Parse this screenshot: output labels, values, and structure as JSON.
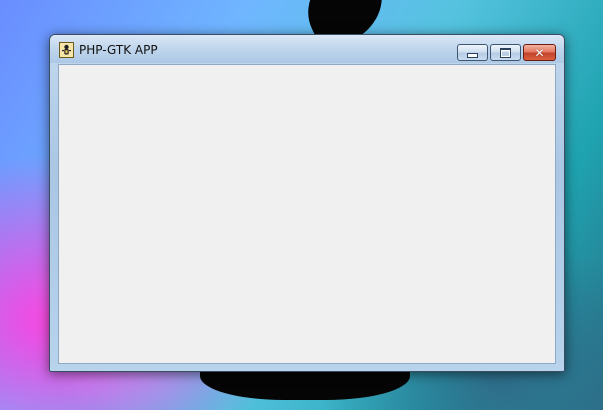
{
  "window": {
    "title": "PHP-GTK APP",
    "app_icon": "php-gtk-app-icon",
    "buttons": {
      "minimize_icon": "minimize-icon",
      "maximize_icon": "maximize-icon",
      "close_icon": "close-icon",
      "close_glyph": "✕"
    },
    "colors": {
      "client_background": "#f0f0f0",
      "close_button": "#c5432b",
      "frame": "#aac6e3"
    }
  }
}
